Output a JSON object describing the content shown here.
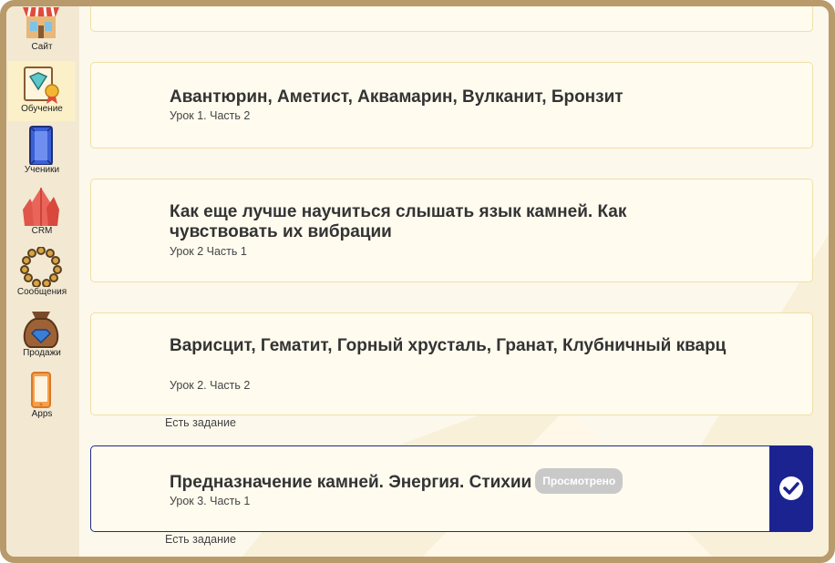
{
  "sidebar": {
    "items": [
      {
        "label": "Сайт",
        "icon": "storefront-icon"
      },
      {
        "label": "Обучение",
        "icon": "diploma-gem-icon",
        "active": true
      },
      {
        "label": "Ученики",
        "icon": "blue-crystal-icon"
      },
      {
        "label": "CRM",
        "icon": "red-crystals-icon"
      },
      {
        "label": "Сообщения",
        "icon": "bead-bracelet-icon"
      },
      {
        "label": "Продажи",
        "icon": "gem-pouch-icon"
      },
      {
        "label": "Apps",
        "icon": "smartphone-icon"
      }
    ]
  },
  "lessons": [
    {
      "title": "Авантюрин, Аметист, Аквамарин, Вулканит, Бронзит",
      "subtitle": "Урок 1. Часть 2"
    },
    {
      "title": "Как еще лучше научиться слышать язык камней. Как чувствовать их вибрации",
      "subtitle": "Урок 2 Часть 1"
    },
    {
      "title": "Варисцит, Гематит, Горный хрусталь, Гранат, Клубничный кварц",
      "subtitle": "Урок 2. Часть 2",
      "task": "Есть задание"
    },
    {
      "title": "Предназначение камней. Энергия. Стихии",
      "subtitle": "Урок 3. Часть 1",
      "badge": "Просмотрено",
      "task": "Есть задание",
      "completed": true
    }
  ],
  "colors": {
    "frame": "#b89a6b",
    "sidebar": "#f3e9d3",
    "card_border": "#f0dfa8",
    "accent": "#1b2390"
  }
}
